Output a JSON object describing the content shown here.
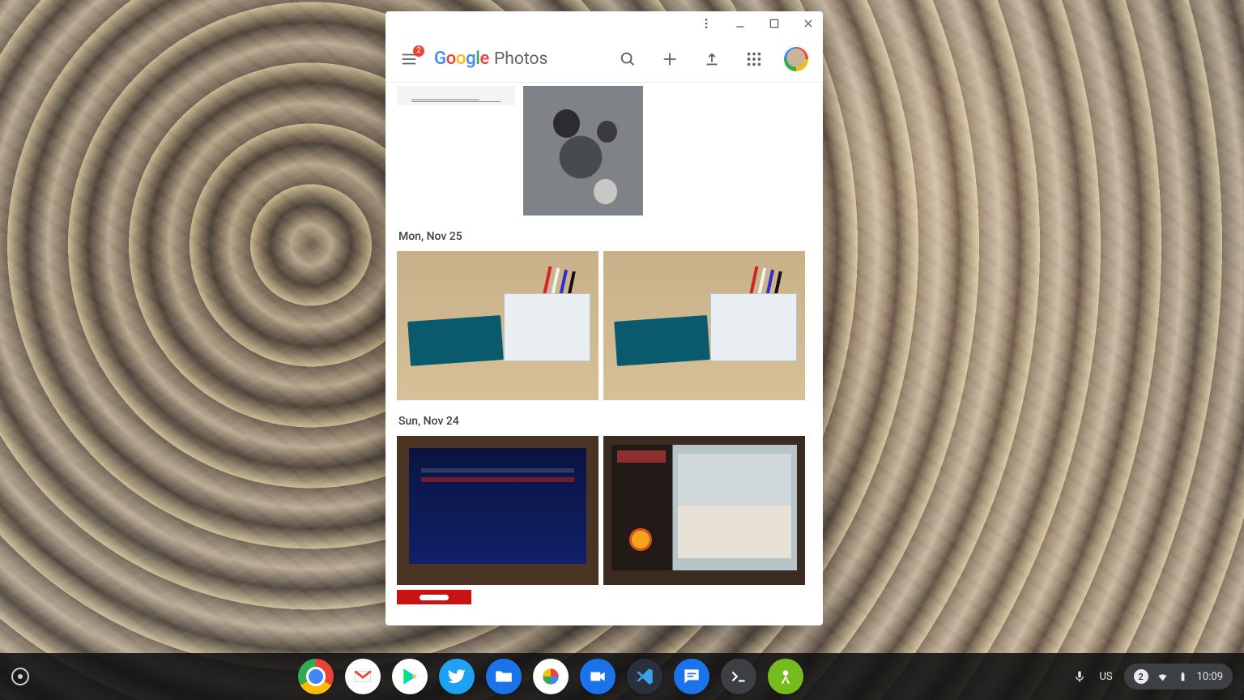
{
  "window": {
    "menu_badge": "2",
    "logo_suffix": "Photos"
  },
  "sections": [
    {
      "label": "Mon, Nov 25"
    },
    {
      "label": "Sun, Nov 24"
    }
  ],
  "tray": {
    "keyboard_layout": "US",
    "notification_count": "2",
    "clock": "10:09"
  }
}
